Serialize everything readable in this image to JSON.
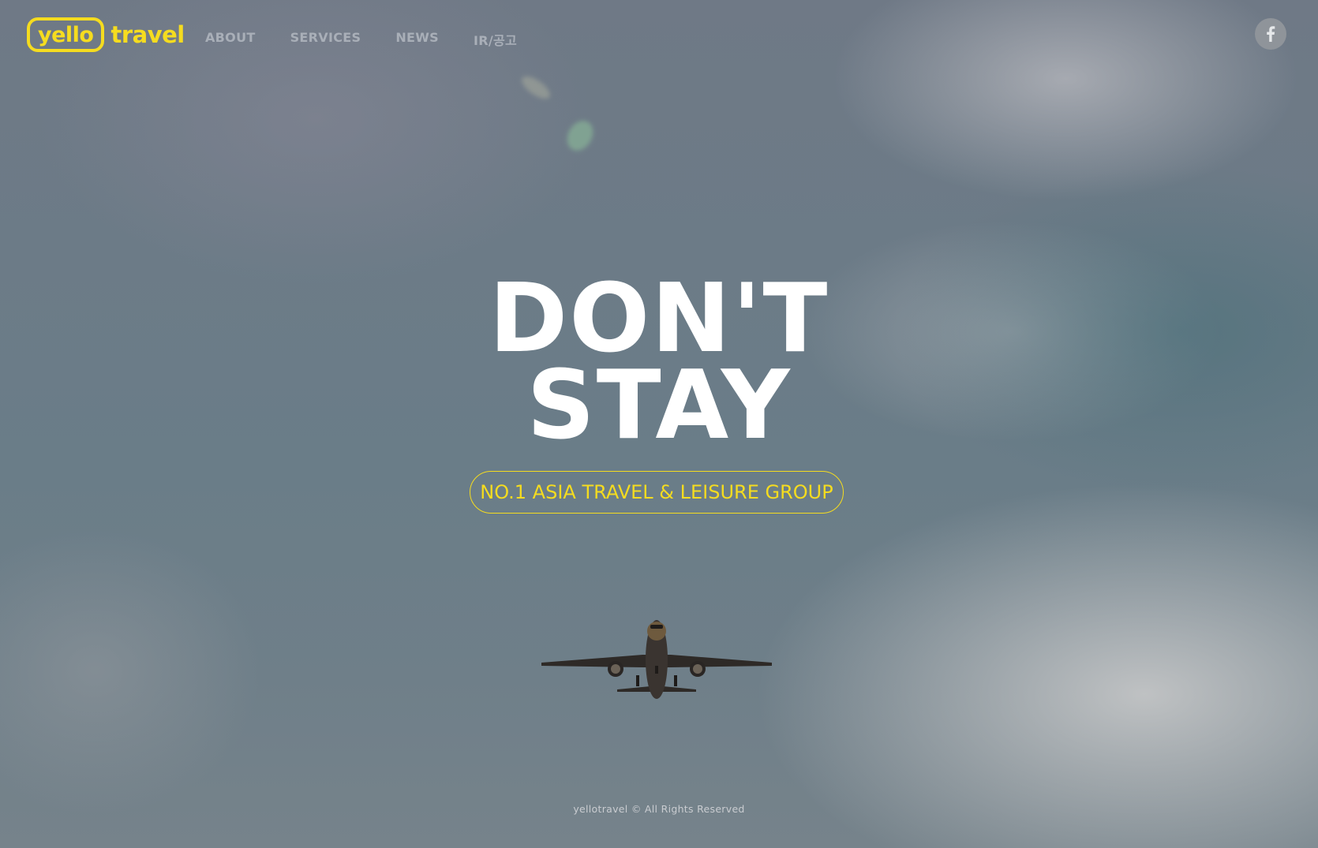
{
  "brand": {
    "logo_word": "yello",
    "logo_suffix": "travel",
    "accent_color": "#f5dc1f"
  },
  "nav": {
    "items": [
      {
        "label": "ABOUT"
      },
      {
        "label": "SERVICES"
      },
      {
        "label": "NEWS"
      },
      {
        "label": "IR/공고"
      }
    ]
  },
  "social": {
    "facebook_glyph": "f",
    "icon": "facebook-icon"
  },
  "hero": {
    "line1": "DON'T",
    "line2": "STAY",
    "tagline": "NO.1 ASIA TRAVEL & LEISURE GROUP",
    "image": "airplane-in-sky"
  },
  "footer": {
    "copyright": "yellotravel © All Rights Reserved"
  }
}
